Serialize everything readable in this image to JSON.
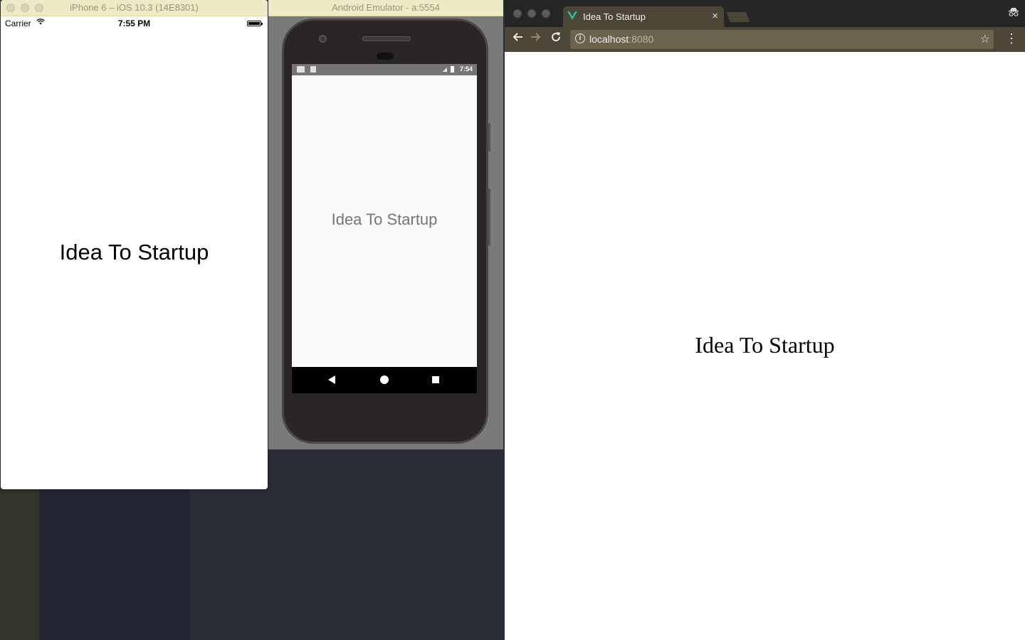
{
  "ios_simulator": {
    "window_title": "iPhone 6 – iOS 10.3 (14E8301)",
    "status": {
      "carrier": "Carrier",
      "time": "7:55 PM"
    },
    "heading": "Idea To Startup"
  },
  "android_emulator": {
    "window_title": "Android Emulator - a:5554",
    "status": {
      "time": "7:54"
    },
    "heading": "Idea To Startup",
    "nav_icons": [
      "back-icon",
      "home-icon",
      "recents-icon"
    ]
  },
  "browser": {
    "tab": {
      "title": "Idea To Startup",
      "favicon": "vue-logo-icon",
      "close_glyph": "×"
    },
    "address": {
      "host": "localhost",
      "port": ":8080"
    },
    "page_heading": "Idea To Startup",
    "toolbar_icons": [
      "back-arrow-icon",
      "forward-arrow-icon",
      "reload-icon",
      "info-icon",
      "star-icon",
      "menu-icon",
      "incognito-icon"
    ]
  }
}
